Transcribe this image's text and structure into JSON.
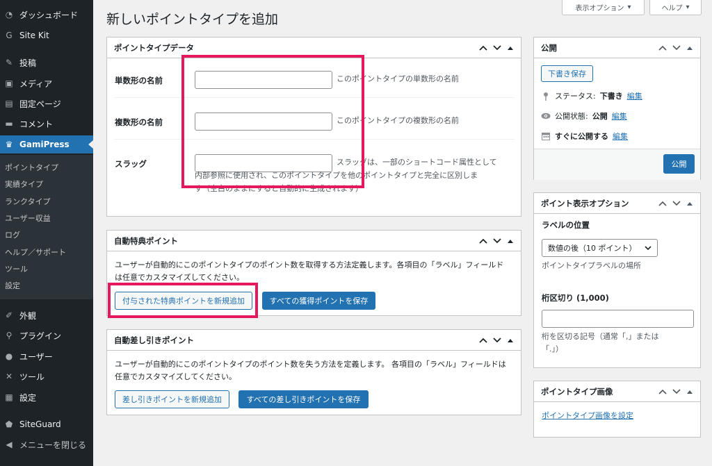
{
  "sidebar": {
    "items": [
      {
        "label": "ダッシュボード",
        "icon": "dashboard-icon"
      },
      {
        "label": "Site Kit",
        "icon": "sitekit-icon"
      },
      {
        "label": "投稿",
        "icon": "pin-icon"
      },
      {
        "label": "メディア",
        "icon": "media-icon"
      },
      {
        "label": "固定ページ",
        "icon": "page-icon"
      },
      {
        "label": "コメント",
        "icon": "comment-icon"
      },
      {
        "label": "GamiPress",
        "icon": "crown-icon"
      },
      {
        "label": "外観",
        "icon": "brush-icon"
      },
      {
        "label": "プラグイン",
        "icon": "plugin-icon"
      },
      {
        "label": "ユーザー",
        "icon": "user-icon"
      },
      {
        "label": "ツール",
        "icon": "wrench-icon"
      },
      {
        "label": "設定",
        "icon": "settings-icon"
      },
      {
        "label": "SiteGuard",
        "icon": "shield-icon"
      },
      {
        "label": "メニューを閉じる",
        "icon": "collapse-icon"
      }
    ],
    "submenu": [
      "ポイントタイプ",
      "実績タイプ",
      "ランクタイプ",
      "ユーザー収益",
      "ログ",
      "ヘルプ／サポート",
      "ツール",
      "設定"
    ]
  },
  "top": {
    "screen_options": "表示オプション",
    "help": "ヘルプ"
  },
  "page_title": "新しいポイントタイプを追加",
  "point_type_data": {
    "title": "ポイントタイプデータ",
    "singular_label": "単数形の名前",
    "singular_desc": "このポイントタイプの単数形の名前",
    "plural_label": "複数形の名前",
    "plural_desc": "このポイントタイプの複数形の名前",
    "slug_label": "スラッグ",
    "slug_desc_1": "スラッグは、一部のショートコード属性として",
    "slug_desc_2": "内部参照に使用され、このポイントタイプを他のポイントタイプと完全に区別しま",
    "slug_desc_3": "す（空白のままにすると自動的に生成されます）"
  },
  "award": {
    "title": "自動特典ポイント",
    "desc_1": "ユーザーが自動的にこのポイントタイプのポイント数を取得する方法定義します。各項目の「ラベル」フィールド",
    "desc_2": "は任意でカスタマイズしてください。",
    "add_button": "付与された特典ポイントを新規追加",
    "save_button": "すべての獲得ポイントを保存"
  },
  "deduct": {
    "title": "自動差し引きポイント",
    "desc_1": "ユーザーが自動的にこのポイントタイプのポイント数を失う方法を定義します。 各項目の「ラベル」フィールドは",
    "desc_2": "任意でカスタマイズしてください。",
    "add_button": "差し引きポイントを新規追加",
    "save_button": "すべての差し引きポイントを保存"
  },
  "publish": {
    "title": "公開",
    "save_draft": "下書き保存",
    "status_label": "ステータス:",
    "status_value": "下書き",
    "visibility_label": "公開状態:",
    "visibility_value": "公開",
    "schedule_label": "すぐに公開する",
    "edit_link": "編集",
    "publish_button": "公開"
  },
  "display_options": {
    "title": "ポイント表示オプション",
    "label_position_heading": "ラベルの位置",
    "label_position_value": "数値の後（10 ポイント）",
    "label_position_desc": "ポイントタイプラベルの場所",
    "thousands_heading": "桁区切り (1,000)",
    "thousands_value": "",
    "thousands_desc_1": "桁を区切る記号（通常「,」または",
    "thousands_desc_2": "「.」）"
  },
  "image_box": {
    "title": "ポイントタイプ画像",
    "set_link": "ポイントタイプ画像を設定"
  },
  "colors": {
    "sidebar_bg": "#1d2327",
    "accent": "#2271b1",
    "highlight": "#e5175d"
  }
}
